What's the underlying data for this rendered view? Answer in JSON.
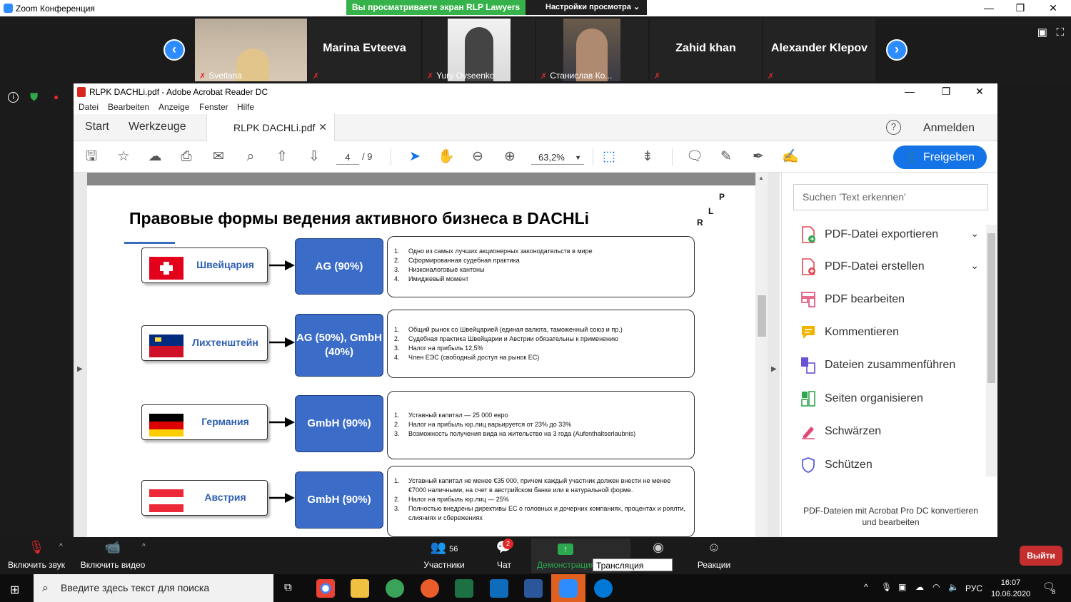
{
  "zoom": {
    "window_title": "Zoom Конференция",
    "share_banner": "Вы просматриваете экран RLP Lawyers",
    "view_options": "Настройки просмотра",
    "participants": [
      {
        "label": "Svetlana",
        "name": ""
      },
      {
        "label": "",
        "name": "Marina Evteeva"
      },
      {
        "label": "Yury Ovseenko",
        "name": ""
      },
      {
        "label": "Станислав Ко...",
        "name": ""
      },
      {
        "label": "",
        "name": "Zahid khan"
      },
      {
        "label": "",
        "name": "Alexander Klepov"
      }
    ],
    "toolbar": {
      "audio": "Включить звук",
      "video": "Включить видео",
      "participants_count": "56",
      "participants": "Участники",
      "chat_badge": "2",
      "chat": "Чат",
      "share": "Демонстрация",
      "tooltip": "Трансляция (Alt+S)",
      "reactions": "Реакции",
      "leave": "Выйти"
    }
  },
  "acrobat": {
    "window_title": "RLPK DACHLi.pdf - Adobe Acrobat Reader DC",
    "menu": [
      "Datei",
      "Bearbeiten",
      "Anzeige",
      "Fenster",
      "Hilfe"
    ],
    "tabs": {
      "start": "Start",
      "tools": "Werkzeuge",
      "doc": "RLPK DACHLi.pdf",
      "signin": "Anmelden"
    },
    "page_current": "4",
    "page_total": "/ 9",
    "zoom": "63,2%",
    "share_button": "Freigeben",
    "search_placeholder": "Suchen 'Text erkennen'",
    "tools": [
      {
        "label": "PDF-Datei exportieren",
        "icon": "export-pdf-icon",
        "color": "#e34850"
      },
      {
        "label": "PDF-Datei erstellen",
        "icon": "create-pdf-icon",
        "color": "#e34850"
      },
      {
        "label": "PDF bearbeiten",
        "icon": "edit-pdf-icon",
        "color": "#e34850"
      },
      {
        "label": "Kommentieren",
        "icon": "comment-icon",
        "color": "#f0b400"
      },
      {
        "label": "Dateien zusammenführen",
        "icon": "combine-icon",
        "color": "#6b4fd6"
      },
      {
        "label": "Seiten organisieren",
        "icon": "organize-icon",
        "color": "#2ea84e"
      },
      {
        "label": "Schwärzen",
        "icon": "redact-icon",
        "color": "#e34875"
      },
      {
        "label": "Schützen",
        "icon": "protect-icon",
        "color": "#5b5fd6"
      }
    ],
    "promo": "PDF-Dateien mit Acrobat Pro DC konvertieren und bearbeiten"
  },
  "slide": {
    "title": "Правовые формы ведения активного бизнеса в DACHLi",
    "logo_letters": [
      "P",
      "L",
      "R"
    ],
    "rows": [
      {
        "country": "Швейцария",
        "form": "AG (90%)",
        "points": [
          "Одно из самых лучших акционерных законодательств в мире",
          "Сформированная судебная практика",
          "Низконалоговые кантоны",
          "Имиджевый момент"
        ]
      },
      {
        "country": "Лихтенштейн",
        "form": "AG (50%), GmbH (40%)",
        "points": [
          "Общий рынок со Швейцарией (единая валюта, таможенный союз и пр.)",
          "Судебная практика Швейцарии и Австрии обязательны к применению",
          "Налог на прибыль 12,5%",
          "Член ЕЭС (свободный доступ на рынок ЕС)"
        ]
      },
      {
        "country": "Германия",
        "form": "GmbH (90%)",
        "points": [
          "Уставный капитал — 25 000 евро",
          "Налог на прибыль юр.лиц варьируется от 23% до 33%",
          "Возможность получения вида на жительство на 3 года (Aufenthaltserlaubnis)"
        ]
      },
      {
        "country": "Австрия",
        "form": "GmbH (90%)",
        "points": [
          "Уставный капитал не менее €35 000, причем каждый участник должен внести не менее €7000 наличными, на счет в австрийском банке или в натуральной форме.",
          "Налог на прибыль юр.лиц — 25%",
          "Полностью внедрены директивы ЕС о головных и дочерних компаниях, процентах и роялти, слияниях и сбережениях"
        ]
      }
    ]
  },
  "taskbar": {
    "search_placeholder": "Введите здесь текст для поиска",
    "lang": "РУС",
    "time": "16:07",
    "date": "10.06.2020",
    "notifications": "8"
  }
}
